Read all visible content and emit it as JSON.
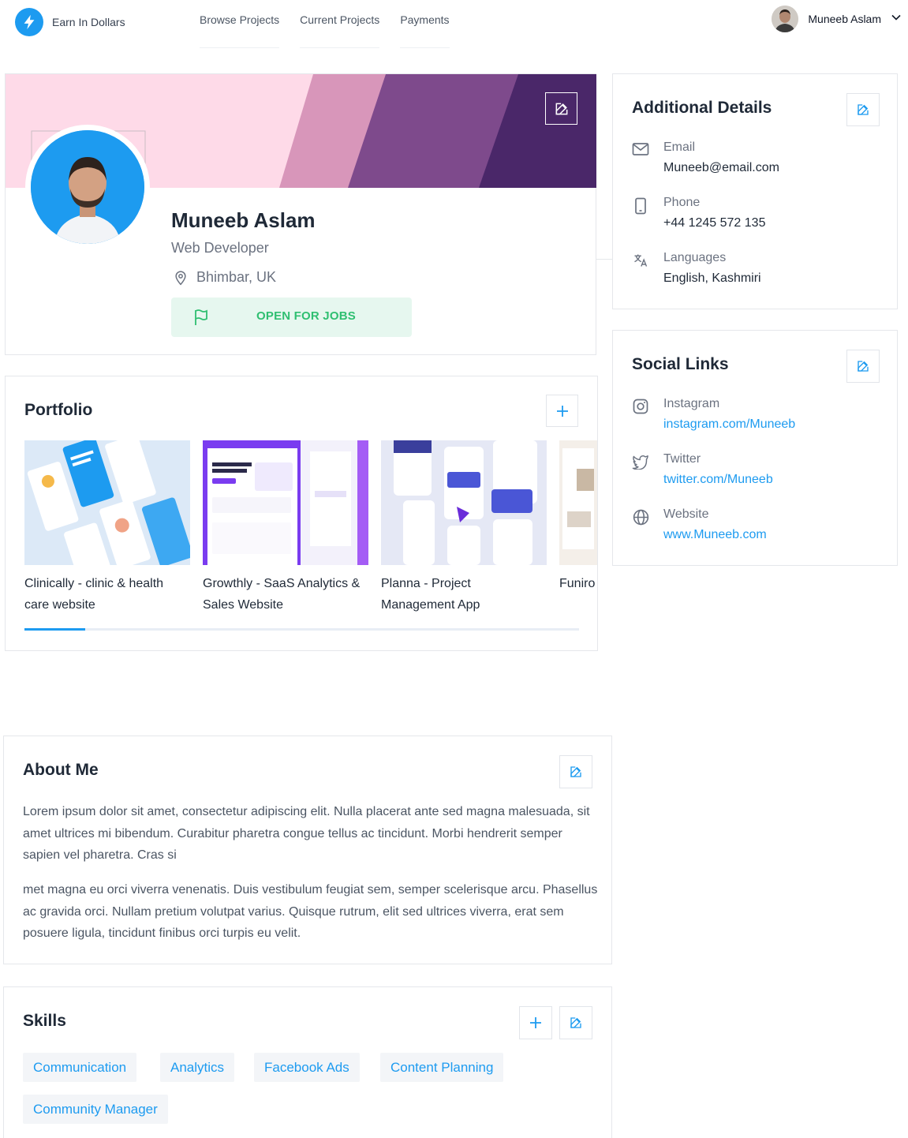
{
  "nav": {
    "brand": "Earn In Dollars",
    "links": [
      "Browse Projects",
      "Current Projects",
      "Payments"
    ],
    "user_name": "Muneeb Aslam"
  },
  "profile": {
    "name": "Muneeb Aslam",
    "role": "Web Developer",
    "location": "Bhimbar, UK",
    "status": "OPEN FOR JOBS",
    "banner_colors": [
      "#fedae8",
      "#d896ba",
      "#7e4a8c",
      "#4a2769"
    ]
  },
  "details": {
    "title": "Additional Details",
    "email_label": "Email",
    "email": "Muneeb@email.com",
    "phone_label": "Phone",
    "phone": "+44 1245 572 135",
    "languages_label": "Languages",
    "languages": "English, Kashmiri"
  },
  "social": {
    "title": "Social Links",
    "instagram_label": "Instagram",
    "instagram": "instagram.com/Muneeb",
    "twitter_label": "Twitter",
    "twitter": "twitter.com/Muneeb",
    "website_label": "Website",
    "website": "www.Muneeb.com"
  },
  "portfolio": {
    "title": "Portfolio",
    "items": [
      {
        "caption": "Clinically - clinic & health care website"
      },
      {
        "caption": "Growthly - SaaS Analytics & Sales Website"
      },
      {
        "caption": "Planna - Project Management App"
      },
      {
        "caption": "Funiro - furniture"
      }
    ],
    "scroll_progress": 0.11
  },
  "about": {
    "title": "About Me",
    "p1": "Lorem ipsum dolor sit amet, consectetur adipiscing elit. Nulla placerat ante sed magna malesuada, sit amet ultrices mi bibendum. Curabitur pharetra congue tellus ac tincidunt. Morbi hendrerit semper sapien vel pharetra. Cras si",
    "p2": "met magna eu orci viverra venenatis. Duis vestibulum feugiat sem, semper scelerisque arcu. Phasellus ac gravida orci. Nullam pretium volutpat varius. Quisque rutrum, elit sed ultrices viverra, erat sem posuere ligula, tincidunt finibus orci turpis eu velit."
  },
  "skills": {
    "title": "Skills",
    "items": [
      "Communication",
      "Analytics",
      "Facebook Ads",
      "Content Planning",
      "Community Manager"
    ]
  },
  "colors": {
    "accent": "#1d9bf0",
    "success": "#2fbf71",
    "success_bg": "#e6f7ef"
  }
}
